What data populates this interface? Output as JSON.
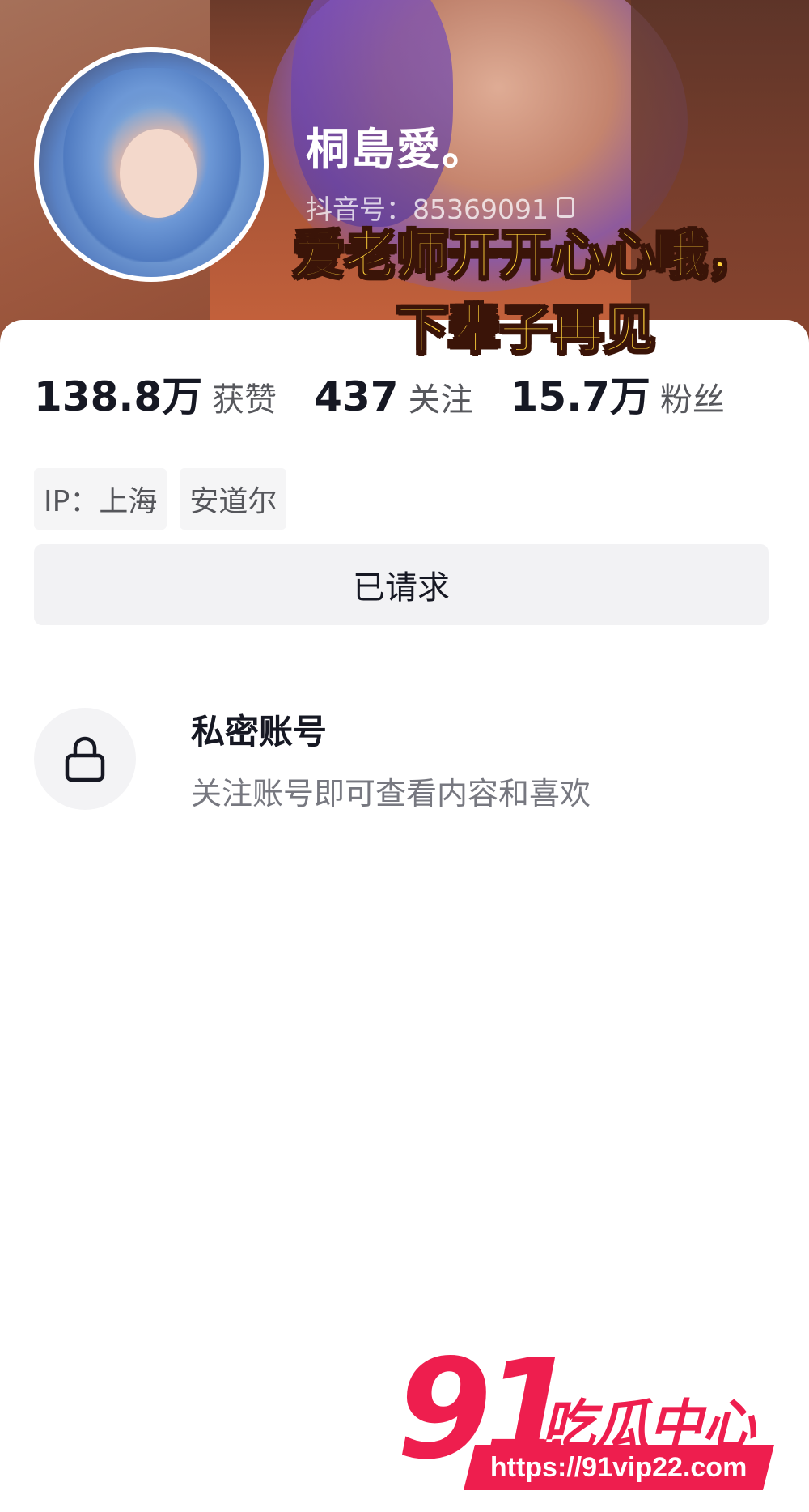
{
  "profile": {
    "nickname": "桐島愛。",
    "douyin_id": "抖音号：85369091"
  },
  "overlay_caption": {
    "line1": "爱老师开开心心哦，",
    "line2": "下辈子再见"
  },
  "stats": {
    "likes_value": "138.8万",
    "likes_label": "获赞",
    "following_value": "437",
    "following_label": "关注",
    "followers_value": "15.7万",
    "followers_label": "粉丝"
  },
  "tags": {
    "ip": "IP：上海",
    "location": "安道尔"
  },
  "request_button": {
    "label": "已请求"
  },
  "private_account": {
    "title": "私密账号",
    "subtitle": "关注账号即可查看内容和喜欢",
    "icon": "lock-icon"
  },
  "watermark": {
    "number": "91",
    "text": "吃瓜中心",
    "url": "https://91vip22.com",
    "color": "#ee1e4e"
  }
}
